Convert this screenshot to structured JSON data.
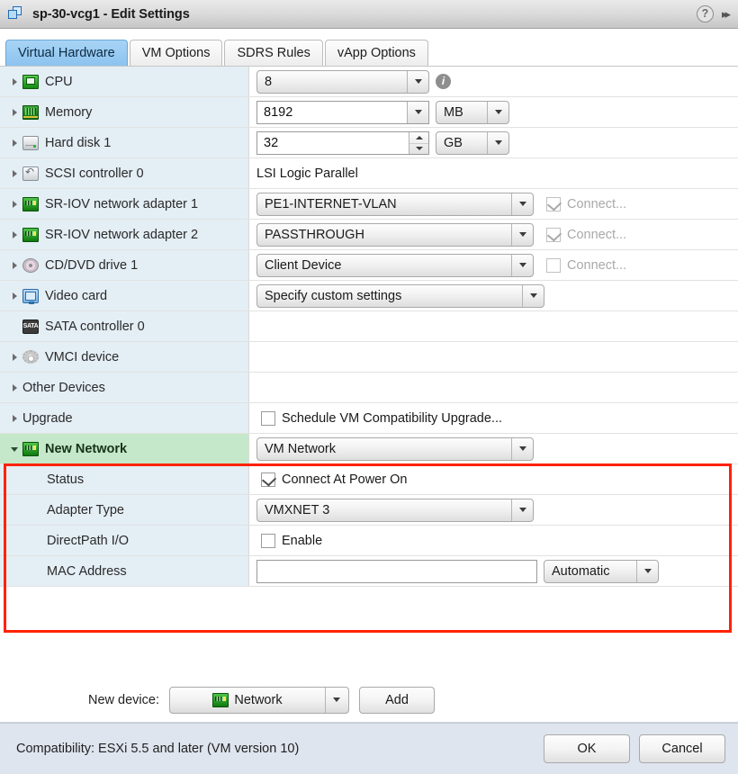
{
  "window": {
    "title": "sp-30-vcg1 - Edit Settings",
    "window_icon": "vm-windows-icon",
    "help_icon": "?",
    "expand_icon": "▸▸",
    "highlight_color": "#ff2200",
    "header_bg": "#dcdcdc"
  },
  "tabs": [
    {
      "label": "Virtual Hardware",
      "active": true
    },
    {
      "label": "VM Options",
      "active": false
    },
    {
      "label": "SDRS Rules",
      "active": false
    },
    {
      "label": "vApp Options",
      "active": false
    }
  ],
  "rows": {
    "cpu": {
      "label": "CPU",
      "value": "8",
      "icon": "cpu-icon",
      "info": "i"
    },
    "memory": {
      "label": "Memory",
      "value": "8192",
      "unit": "MB",
      "icon": "memory-icon"
    },
    "harddisk": {
      "label": "Hard disk 1",
      "value": "32",
      "unit": "GB",
      "icon": "hard-disk-icon"
    },
    "scsi": {
      "label": "SCSI controller 0",
      "value": "LSI Logic Parallel",
      "icon": "scsi-controller-icon"
    },
    "sriov1": {
      "label": "SR-IOV network adapter 1",
      "value": "PE1-INTERNET-VLAN",
      "connect_label": "Connect...",
      "connect_checked": true,
      "icon": "network-adapter-icon"
    },
    "sriov2": {
      "label": "SR-IOV network adapter 2",
      "value": "PASSTHROUGH",
      "connect_label": "Connect...",
      "connect_checked": true,
      "icon": "network-adapter-icon"
    },
    "cddvd": {
      "label": "CD/DVD drive 1",
      "value": "Client Device",
      "connect_label": "Connect...",
      "connect_checked": false,
      "icon": "cd-dvd-icon"
    },
    "video": {
      "label": "Video card",
      "value": "Specify custom settings",
      "icon": "video-card-icon"
    },
    "sata": {
      "label": "SATA controller 0",
      "value": "",
      "icon": "sata-controller-icon",
      "icon_text": "SATA"
    },
    "vmci": {
      "label": "VMCI device",
      "value": "",
      "icon": "vmci-gear-icon"
    },
    "other": {
      "label": "Other Devices",
      "value": ""
    },
    "upgrade": {
      "label": "Upgrade",
      "checkbox_label": "Schedule VM Compatibility Upgrade...",
      "checked": false
    }
  },
  "new_network": {
    "label": "New Network",
    "icon": "network-adapter-icon",
    "value": "VM Network",
    "children": [
      {
        "label": "Status",
        "type": "checkbox",
        "checkbox_label": "Connect At Power On",
        "checked": true
      },
      {
        "label": "Adapter Type",
        "type": "combo",
        "value": "VMXNET 3"
      },
      {
        "label": "DirectPath I/O",
        "type": "checkbox",
        "checkbox_label": "Enable",
        "checked": false
      },
      {
        "label": "MAC Address",
        "type": "mac",
        "value": "",
        "mode": "Automatic"
      }
    ]
  },
  "new_device_bar": {
    "label": "New device:",
    "selected": "Network",
    "selected_icon": "network-adapter-icon",
    "add_label": "Add"
  },
  "footer": {
    "compatibility": "Compatibility: ESXi 5.5 and later (VM version 10)",
    "ok_label": "OK",
    "cancel_label": "Cancel"
  }
}
